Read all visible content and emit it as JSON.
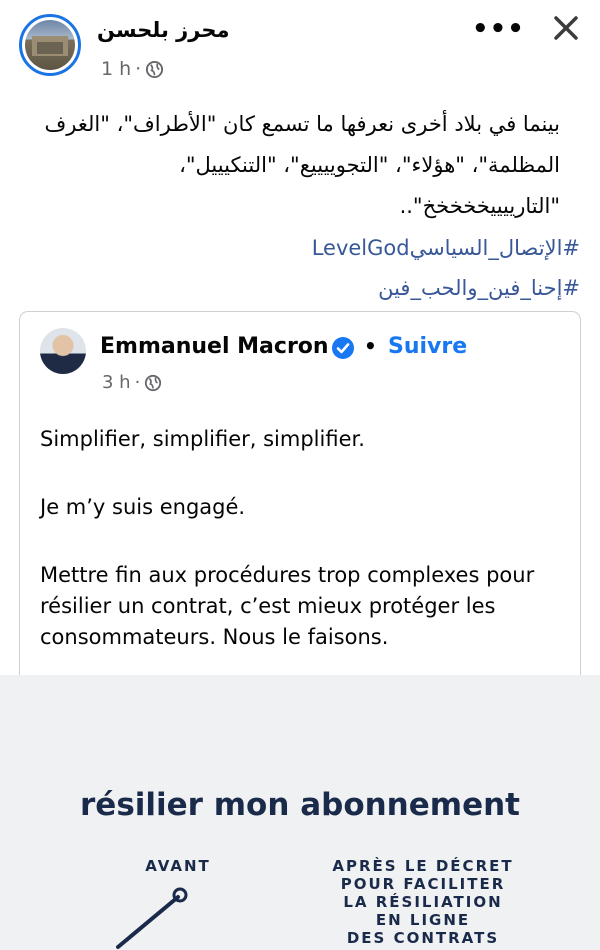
{
  "post": {
    "author": "محرز بلحسن",
    "time": "1 h",
    "time_sep": "·",
    "text": "بينما في بلاد أخرى نعرفها ما تسمع كان \"الأطراف\"، \"الغرف المظلمة\"، \"هؤلاء\"، \"التجوييييع\"، \"التنكيييل\"، \"التارييييخخخخخ\"..",
    "hashtags": [
      "#الإتصال_السياسيLevelGod",
      "#إحنا_فين_والحب_فين"
    ]
  },
  "shared": {
    "name": "Emmanuel Macron",
    "dot": "•",
    "follow": "Suivre",
    "time": "3 h",
    "time_sep": "·",
    "paragraphs": [
      "Simplifier, simplifier, simplifier.",
      "Je m’y suis engagé.",
      "Mettre fin aux procédures trop complexes pour résilier un contrat, c’est mieux protéger les consommateurs. Nous le faisons."
    ]
  },
  "image": {
    "title": "résilier mon abonnement",
    "left_label": "AVANT",
    "right_label": "APRÈS LE DÉCRET\nPOUR FACILITER\nLA RÉSILIATION\nEN LIGNE\nDES CONTRATS"
  },
  "colors": {
    "link": "#385898",
    "follow": "#1877f2",
    "verified": "#1877f2",
    "navy": "#1a2a4a"
  },
  "icons": {
    "privacy": "globe-icon",
    "more": "more-options-icon",
    "close": "close-icon",
    "verified": "verified-badge-icon"
  }
}
